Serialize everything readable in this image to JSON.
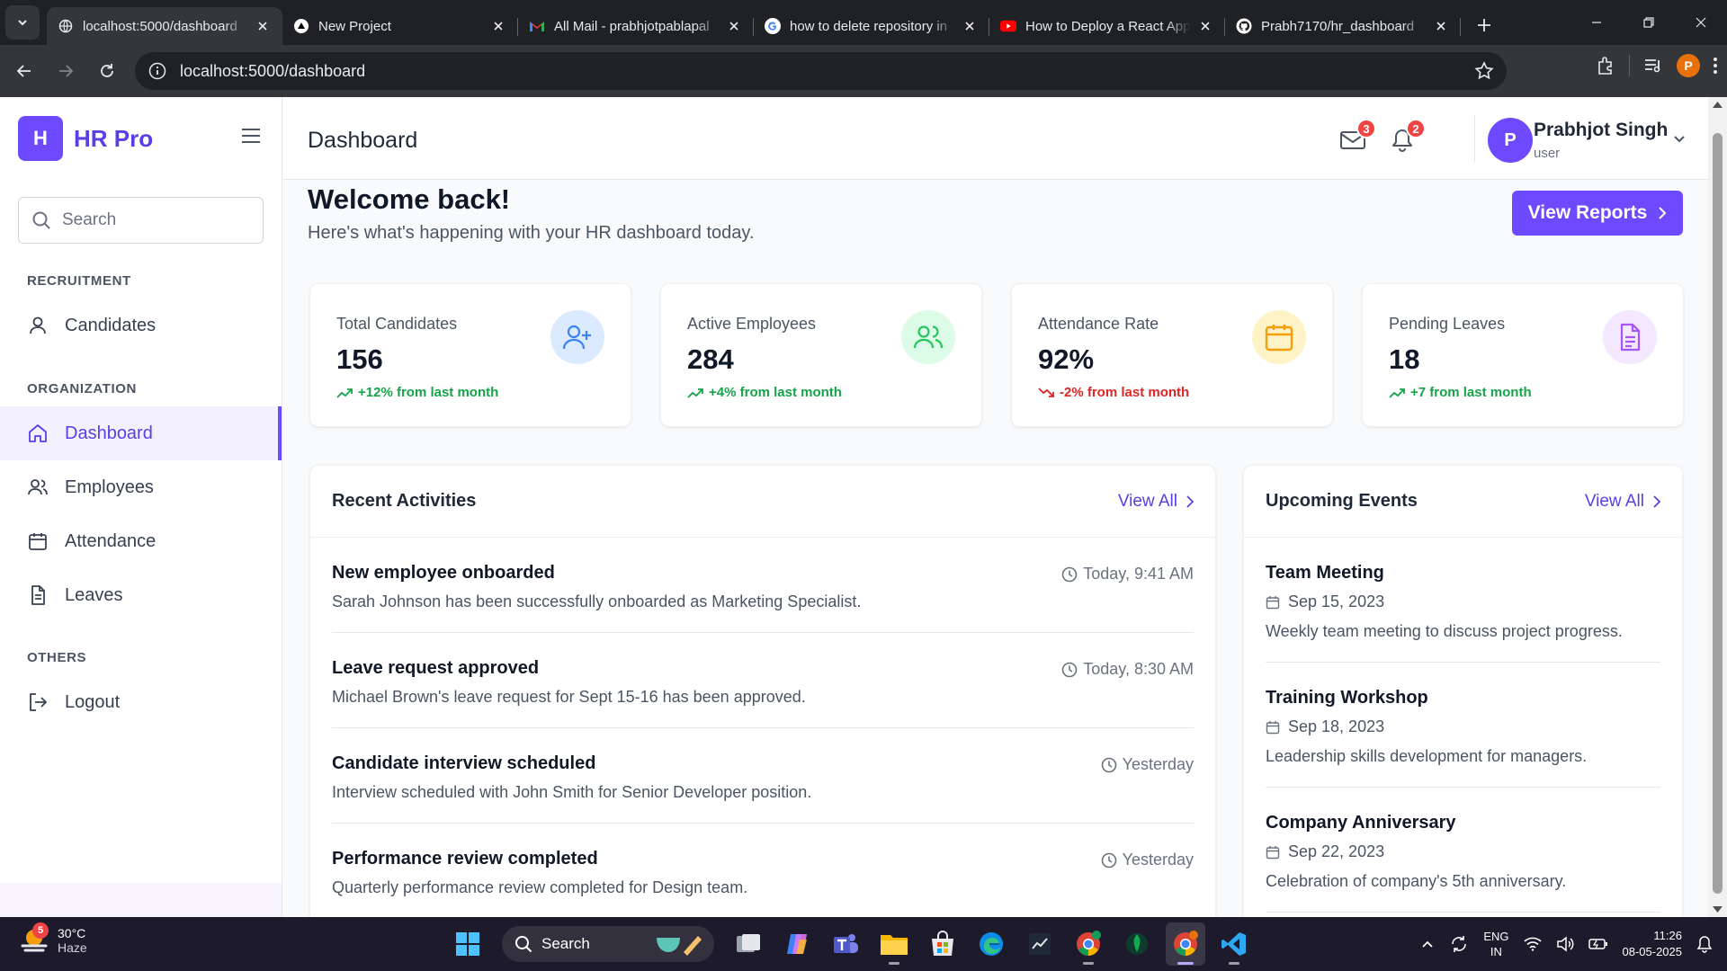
{
  "browser": {
    "tabs": [
      {
        "title": "localhost:5000/dashboard",
        "active": true,
        "icon": "globe-icon"
      },
      {
        "title": "New Project",
        "active": false,
        "icon": "vercel-icon"
      },
      {
        "title": "All Mail - prabhjotpablapal",
        "active": false,
        "icon": "gmail-icon"
      },
      {
        "title": "how to delete repository in",
        "active": false,
        "icon": "google-icon"
      },
      {
        "title": "How to Deploy a React App",
        "active": false,
        "icon": "youtube-icon"
      },
      {
        "title": "Prabh7170/hr_dashboard",
        "active": false,
        "icon": "github-icon"
      }
    ],
    "url": "localhost:5000/dashboard",
    "profile_initial": "P"
  },
  "sidebar": {
    "logo_letter": "H",
    "brand": "HR Pro",
    "search_placeholder": "Search",
    "sections": {
      "recruitment": "RECRUITMENT",
      "organization": "ORGANIZATION",
      "others": "OTHERS"
    },
    "items": {
      "candidates": "Candidates",
      "dashboard": "Dashboard",
      "employees": "Employees",
      "attendance": "Attendance",
      "leaves": "Leaves",
      "logout": "Logout"
    }
  },
  "header": {
    "title": "Dashboard",
    "mail_count": "3",
    "notification_count": "2",
    "user_initial": "P",
    "user_name": "Prabhjot Singh",
    "user_role": "user"
  },
  "welcome": {
    "title": "Welcome back!",
    "subtitle": "Here's what's happening with your HR dashboard today.",
    "button": "View Reports"
  },
  "stats": [
    {
      "label": "Total Candidates",
      "value": "156",
      "trend": "+12% from last month",
      "direction": "up",
      "icon": "user-plus-icon",
      "icon_bg": "#dbeafe",
      "icon_color": "#3b82f6"
    },
    {
      "label": "Active Employees",
      "value": "284",
      "trend": "+4% from last month",
      "direction": "up",
      "icon": "users-icon",
      "icon_bg": "#dcfce7",
      "icon_color": "#22c55e"
    },
    {
      "label": "Attendance Rate",
      "value": "92%",
      "trend": "-2% from last month",
      "direction": "down",
      "icon": "calendar-icon",
      "icon_bg": "#fef3c7",
      "icon_color": "#f59e0b"
    },
    {
      "label": "Pending Leaves",
      "value": "18",
      "trend": "+7 from last month",
      "direction": "up",
      "icon": "document-icon",
      "icon_bg": "#f3e8ff",
      "icon_color": "#a855f7"
    }
  ],
  "activities": {
    "title": "Recent Activities",
    "view_all": "View All",
    "items": [
      {
        "title": "New employee onboarded",
        "desc": "Sarah Johnson has been successfully onboarded as Marketing Specialist.",
        "time": "Today, 9:41 AM"
      },
      {
        "title": "Leave request approved",
        "desc": "Michael Brown's leave request for Sept 15-16 has been approved.",
        "time": "Today, 8:30 AM"
      },
      {
        "title": "Candidate interview scheduled",
        "desc": "Interview scheduled with John Smith for Senior Developer position.",
        "time": "Yesterday"
      },
      {
        "title": "Performance review completed",
        "desc": "Quarterly performance review completed for Design team.",
        "time": "Yesterday"
      }
    ]
  },
  "events": {
    "title": "Upcoming Events",
    "view_all": "View All",
    "items": [
      {
        "title": "Team Meeting",
        "date": "Sep 15, 2023",
        "desc": "Weekly team meeting to discuss project progress."
      },
      {
        "title": "Training Workshop",
        "date": "Sep 18, 2023",
        "desc": "Leadership skills development for managers."
      },
      {
        "title": "Company Anniversary",
        "date": "Sep 22, 2023",
        "desc": "Celebration of company's 5th anniversary."
      }
    ]
  },
  "taskbar": {
    "weather_temp": "30°C",
    "weather_cond": "Haze",
    "weather_badge": "5",
    "search": "Search",
    "lang_1": "ENG",
    "lang_2": "IN",
    "time": "11:26",
    "date": "08-05-2025"
  }
}
